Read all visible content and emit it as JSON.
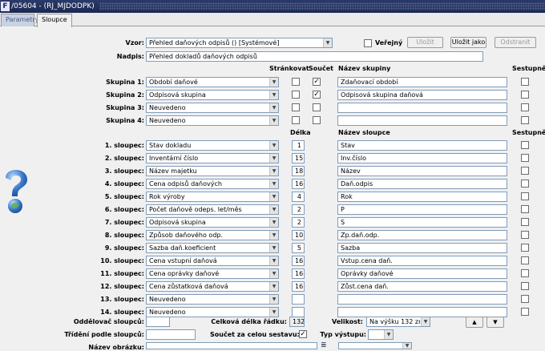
{
  "window": {
    "title": "/05604 - (RJ_MJDODPK)"
  },
  "tabs": [
    {
      "label": "Parametry"
    },
    {
      "label": "Sloupce"
    }
  ],
  "form": {
    "vzor_label": "Vzor:",
    "vzor_value": "Přehled daňových odpisů   ()   [Systémové]",
    "verejny_label": "Veřejný",
    "ulozit_label": "Uložit",
    "ulozit_jako_label": "Uložit jako",
    "odstranit_label": "Odstranit",
    "nadpis_label": "Nadpis:",
    "nadpis_value": "Přehled dokladů daňových odpisů"
  },
  "group_headers": {
    "strankovat": "Stránkovat",
    "soucet": "Součet",
    "nazev_skupiny": "Název skupiny",
    "sestupne": "Sestupně"
  },
  "groups": [
    {
      "label": "Skupina 1:",
      "value": "Období daňové",
      "strankovat": false,
      "soucet": true,
      "name": "Zdaňovací období",
      "sestupne": false
    },
    {
      "label": "Skupina 2:",
      "value": "Odpisová skupina",
      "strankovat": false,
      "soucet": true,
      "name": "Odpisová skupina daňová",
      "sestupne": false
    },
    {
      "label": "Skupina 3:",
      "value": "Neuvedeno",
      "strankovat": false,
      "soucet": false,
      "name": "",
      "sestupne": false
    },
    {
      "label": "Skupina 4:",
      "value": "Neuvedeno",
      "strankovat": false,
      "soucet": false,
      "name": "",
      "sestupne": false
    }
  ],
  "column_headers": {
    "delka": "Délka",
    "nazev_sloupce": "Název sloupce",
    "sestupne": "Sestupně"
  },
  "columns": [
    {
      "label": "1. sloupec:",
      "value": "Stav dokladu",
      "length": "1",
      "name": "Stav"
    },
    {
      "label": "2. sloupec:",
      "value": "Inventární číslo",
      "length": "15",
      "name": "Inv.číslo"
    },
    {
      "label": "3. sloupec:",
      "value": "Název majetku",
      "length": "18",
      "name": "Název"
    },
    {
      "label": "4. sloupec:",
      "value": "Cena odpisů daňových",
      "length": "16",
      "name": "Daň.odpis"
    },
    {
      "label": "5. sloupec:",
      "value": "Rok výroby",
      "length": "4",
      "name": "Rok"
    },
    {
      "label": "6. sloupec:",
      "value": "Počet daňově odeps. let/měs",
      "length": "2",
      "name": "P"
    },
    {
      "label": "7. sloupec:",
      "value": "Odpisová skupina",
      "length": "2",
      "name": "S"
    },
    {
      "label": "8. sloupec:",
      "value": "Způsob daňového odp.",
      "length": "10",
      "name": "Zp.daň.odp."
    },
    {
      "label": "9. sloupec:",
      "value": "Sazba daň.koeficient",
      "length": "5",
      "name": "Sazba"
    },
    {
      "label": "10. sloupec:",
      "value": "Cena vstupní daňová",
      "length": "16",
      "name": "Vstup.cena daň."
    },
    {
      "label": "11. sloupec:",
      "value": "Cena oprávky daňové",
      "length": "16",
      "name": "Oprávky daňové"
    },
    {
      "label": "12. sloupec:",
      "value": "Cena zůstatková daňová",
      "length": "16",
      "name": "Zůst.cena daň."
    },
    {
      "label": "13. sloupec:",
      "value": "Neuvedeno",
      "length": "",
      "name": ""
    },
    {
      "label": "14. sloupec:",
      "value": "Neuvedeno",
      "length": "",
      "name": ""
    }
  ],
  "footer": {
    "oddelovac_label": "Oddělovač sloupců:",
    "oddelovac_value": "",
    "celkova_delka_label": "Celková délka řádku:",
    "celkova_delka_value": "132",
    "velikost_label": "Velikost:",
    "velikost_value": "Na výšku 132 zn.",
    "trideni_label": "Třídění podle sloupců:",
    "trideni_value": "",
    "soucet_celou_label": "Součet za celou sestavu:",
    "soucet_celou_checked": true,
    "typ_vystupu_label": "Typ výstupu:",
    "typ_vystupu_value": "",
    "nazev_obrazku_label": "Název obrázku:",
    "nazev_obrazku_value": "",
    "obrazek_select_value": ""
  },
  "colors": {
    "titlebar": "#1b2850",
    "field_border": "#7f9db9",
    "help_icon": "#3a78c8"
  }
}
